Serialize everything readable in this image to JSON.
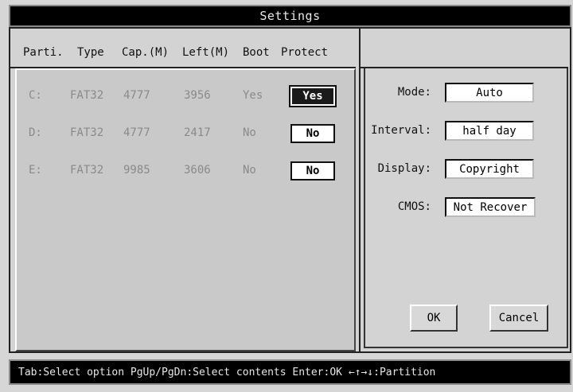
{
  "window": {
    "title": "Settings"
  },
  "table": {
    "headers": [
      "Parti.",
      "Type",
      "Cap.(M)",
      "Left(M)",
      "Boot",
      "Protect"
    ],
    "rows": [
      {
        "partition": "C:",
        "type": "FAT32",
        "capacity": "4777",
        "left": "3956",
        "boot": "Yes",
        "protect": "Yes",
        "selected": true
      },
      {
        "partition": "D:",
        "type": "FAT32",
        "capacity": "4777",
        "left": "2417",
        "boot": "No",
        "protect": "No",
        "selected": false
      },
      {
        "partition": "E:",
        "type": "FAT32",
        "capacity": "9985",
        "left": "3606",
        "boot": "No",
        "protect": "No",
        "selected": false
      }
    ]
  },
  "options": {
    "mode": {
      "label": "Mode:",
      "value": "Auto"
    },
    "interval": {
      "label": "Interval:",
      "value": "half day"
    },
    "display": {
      "label": "Display:",
      "value": "Copyright"
    },
    "cmos": {
      "label": "CMOS:",
      "value": "Not Recover"
    }
  },
  "buttons": {
    "ok": "OK",
    "cancel": "Cancel"
  },
  "status": {
    "text": "Tab:Select option PgUp/PgDn:Select contents Enter:OK ←↑→↓:Partition"
  }
}
